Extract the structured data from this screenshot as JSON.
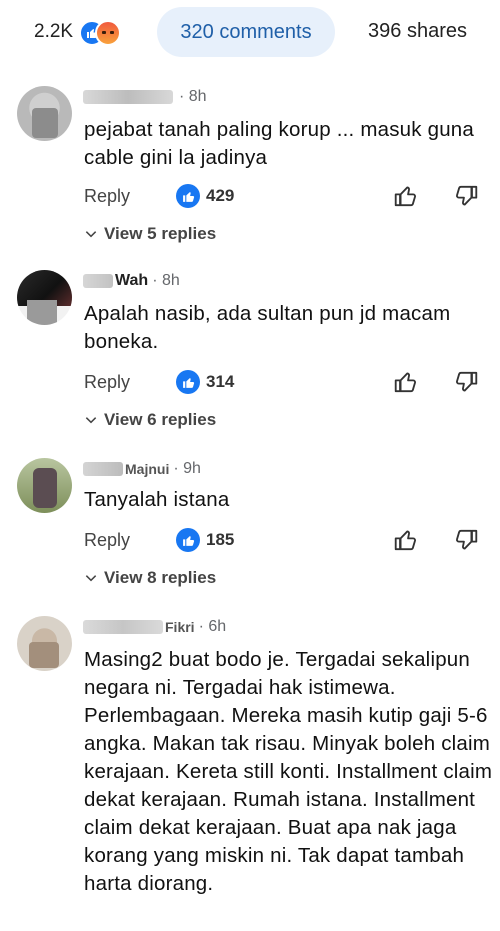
{
  "header": {
    "reaction_count": "2.2K",
    "comments_label": "320 comments",
    "shares_label": "396 shares",
    "icons": [
      "like-icon",
      "angry-icon"
    ],
    "accent_color": "#1877f2"
  },
  "comments": [
    {
      "author": "",
      "time": "8h",
      "text": "pejabat tanah paling korup ... masuk guna cable gini la jadinya",
      "reply_label": "Reply",
      "likes": "429",
      "view_replies": "View 5 replies"
    },
    {
      "author": "Wah",
      "time": "8h",
      "text": "Apalah nasib, ada sultan pun jd macam boneka.",
      "reply_label": "Reply",
      "likes": "314",
      "view_replies": "View 6 replies"
    },
    {
      "author": "Majnui",
      "time": "9h",
      "text": "Tanyalah istana",
      "reply_label": "Reply",
      "likes": "185",
      "view_replies": "View 8 replies"
    },
    {
      "author": "Fikri",
      "time": "6h",
      "text": "Masing2 buat bodo je. Tergadai sekalipun negara ni. Tergadai hak istimewa. Perlembagaan. Mereka masih kutip gaji 5-6 angka. Makan tak risau. Minyak boleh claim kerajaan. Kereta still konti. Installment claim dekat kerajaan. Rumah istana. Installment claim dekat kerajaan. Buat apa nak jaga korang yang miskin ni. Tak dapat tambah harta diorang."
    }
  ]
}
